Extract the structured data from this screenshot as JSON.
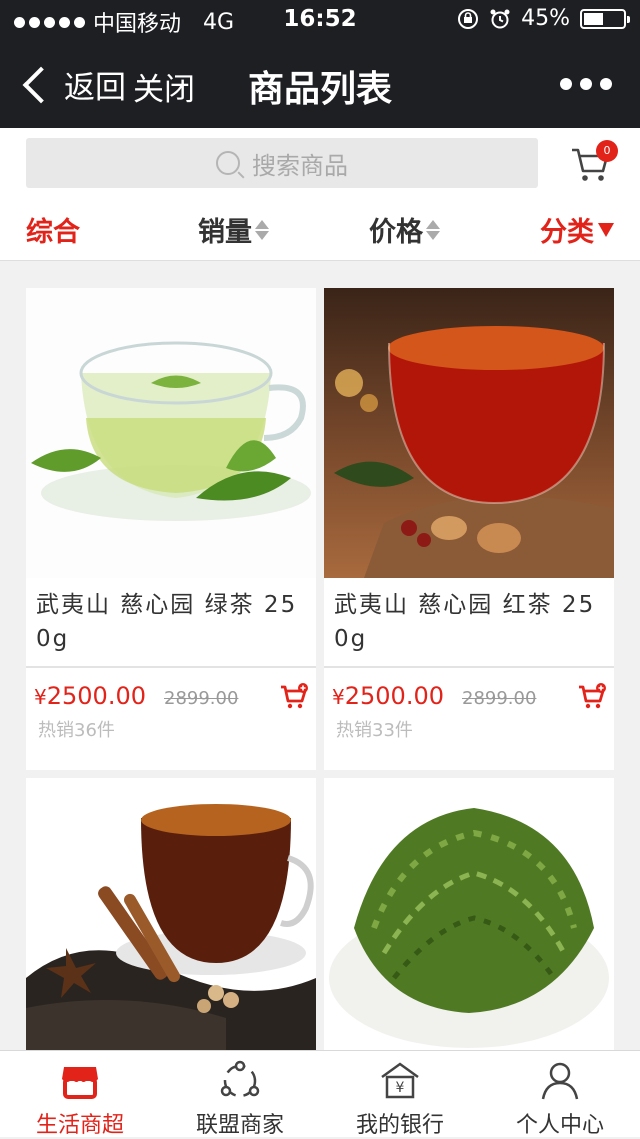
{
  "status": {
    "carrier": "中国移动",
    "network": "4G",
    "time": "16:52",
    "battery": "45%"
  },
  "nav": {
    "back_label": "返回",
    "close_label": "关闭",
    "title": "商品列表"
  },
  "search": {
    "placeholder": "搜索商品"
  },
  "cart": {
    "count": "0"
  },
  "sort": {
    "tabs": [
      "综合",
      "销量",
      "价格",
      "分类"
    ]
  },
  "products": [
    {
      "name_line1": "武夷山 慈心园 绿茶 25",
      "name_line2": "0g",
      "price": "2500.00",
      "currency": "¥",
      "old_price": "2899.00",
      "sold": "热销36件"
    },
    {
      "name_line1": "武夷山 慈心园 红茶 25",
      "name_line2": "0g",
      "price": "2500.00",
      "currency": "¥",
      "old_price": "2899.00",
      "sold": "热销33件"
    },
    {
      "name_line1": "",
      "name_line2": "",
      "price": "",
      "currency": "",
      "old_price": "",
      "sold": ""
    },
    {
      "name_line1": "",
      "name_line2": "",
      "price": "",
      "currency": "",
      "old_price": "",
      "sold": ""
    }
  ],
  "tabbar": {
    "items": [
      "生活商超",
      "联盟商家",
      "我的银行",
      "个人中心"
    ]
  },
  "colors": {
    "accent": "#e2231a",
    "nav_bg": "#1e1f23",
    "page_bg": "#f1f1f1"
  },
  "icons": [
    "back-chevron-icon",
    "more-dots-icon",
    "search-icon",
    "cart-icon",
    "add-to-cart-icon",
    "store-icon",
    "network-icon",
    "bank-icon",
    "person-icon"
  ]
}
